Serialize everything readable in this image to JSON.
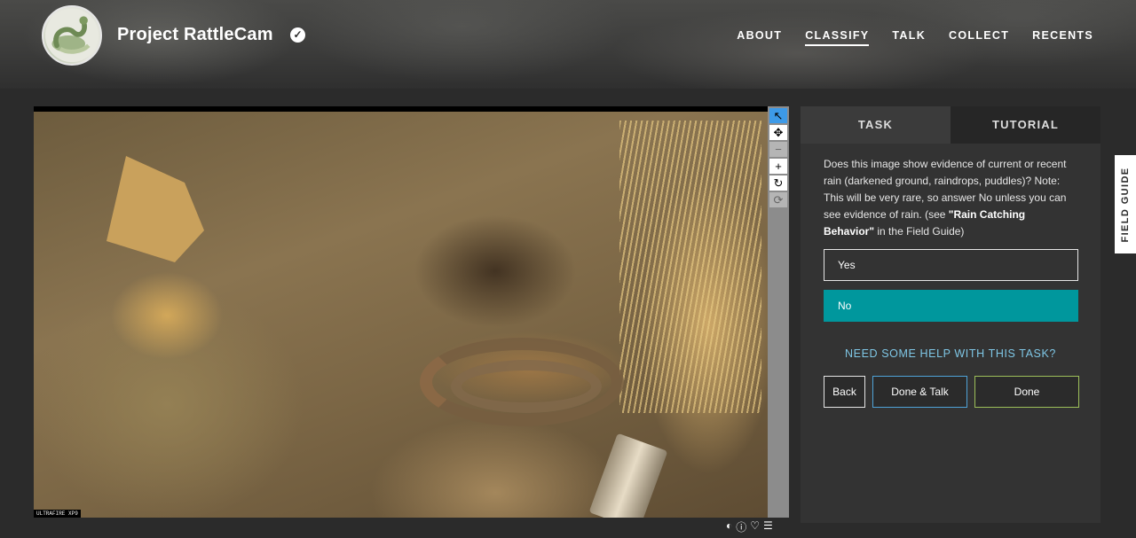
{
  "project": {
    "title": "Project RattleCam",
    "verified_icon": "check-circle-icon"
  },
  "nav": [
    {
      "label": "ABOUT"
    },
    {
      "label": "CLASSIFY",
      "active": true
    },
    {
      "label": "TALK"
    },
    {
      "label": "COLLECT"
    },
    {
      "label": "RECENTS"
    }
  ],
  "camera": {
    "timestamp": "2020-08-25 09:50:00 AM",
    "temperature": "32°C",
    "frame": "T 1/1",
    "model": "ULTRAFIRE XP9"
  },
  "toolbar": [
    {
      "icon": "pointer-icon",
      "glyph": "↖",
      "active": true
    },
    {
      "icon": "move-icon",
      "glyph": "✥"
    },
    {
      "icon": "zoom-out-icon",
      "glyph": "−",
      "disabled": true
    },
    {
      "icon": "zoom-in-icon",
      "glyph": "+"
    },
    {
      "icon": "rotate-icon",
      "glyph": "↻"
    },
    {
      "icon": "reset-icon",
      "glyph": "⟳",
      "disabled": true
    }
  ],
  "meta_icons": [
    "invert-icon",
    "info-icon",
    "favorite-icon",
    "collections-icon"
  ],
  "panel": {
    "tabs": [
      {
        "label": "TASK",
        "active": true
      },
      {
        "label": "TUTORIAL"
      }
    ],
    "question_part1": "Does this image show evidence of current or recent rain (darkened ground, raindrops, puddles)? Note: This will be very rare, so answer No unless you can see evidence of rain. (see ",
    "question_bold": "\"Rain Catching Behavior\"",
    "question_part2": " in the Field Guide)",
    "answers": [
      {
        "label": "Yes"
      },
      {
        "label": "No",
        "selected": true
      }
    ],
    "help_label": "NEED SOME HELP WITH THIS TASK?",
    "buttons": {
      "back": "Back",
      "done_talk": "Done & Talk",
      "done": "Done"
    }
  },
  "field_guide_label": "FIELD GUIDE",
  "colors": {
    "accent": "#00979d",
    "help": "#7fc7e6",
    "done_border": "#9cbf59",
    "talk_border": "#4fa3d8"
  }
}
